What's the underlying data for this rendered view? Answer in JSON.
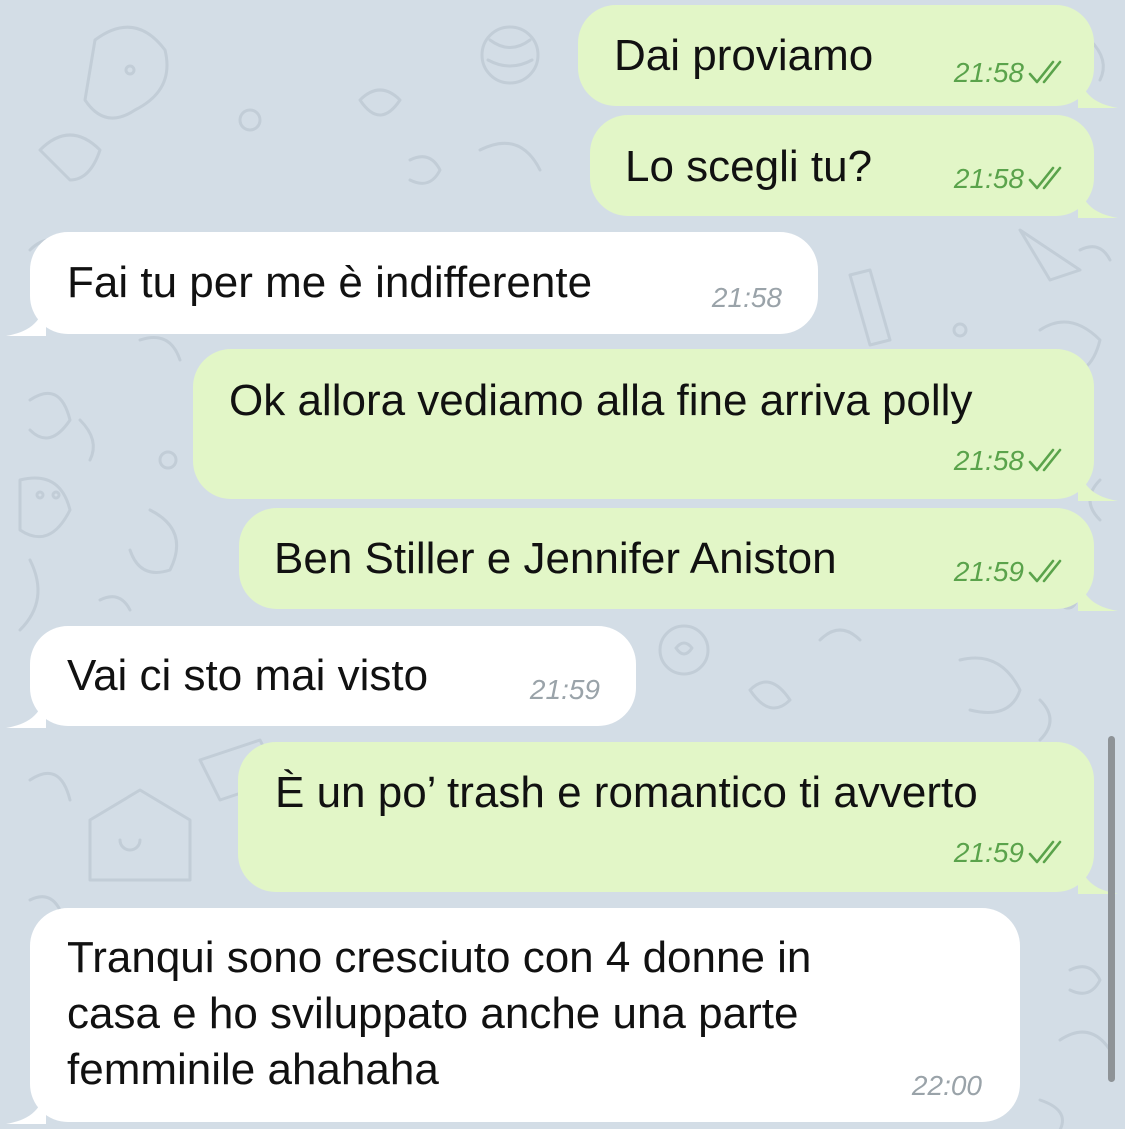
{
  "colors": {
    "background": "#d3dde6",
    "outgoing_bubble": "#e2f6c7",
    "incoming_bubble": "#ffffff",
    "outgoing_meta": "#5aa34b",
    "incoming_meta": "#9aa3a9"
  },
  "messages": [
    {
      "direction": "outgoing",
      "text": "Dai proviamo",
      "time": "21:58",
      "status_icon": "double-check-icon"
    },
    {
      "direction": "outgoing",
      "text": "Lo scegli tu?",
      "time": "21:58",
      "status_icon": "double-check-icon"
    },
    {
      "direction": "incoming",
      "text": "Fai tu per me è indifferente",
      "time": "21:58"
    },
    {
      "direction": "outgoing",
      "text": "Ok allora vediamo alla fine arriva polly",
      "time": "21:58",
      "status_icon": "double-check-icon"
    },
    {
      "direction": "outgoing",
      "text": "Ben Stiller e Jennifer Aniston",
      "time": "21:59",
      "status_icon": "double-check-icon"
    },
    {
      "direction": "incoming",
      "text": "Vai ci sto mai visto",
      "time": "21:59"
    },
    {
      "direction": "outgoing",
      "text": "È un po’ trash e romantico ti avverto",
      "time": "21:59",
      "status_icon": "double-check-icon"
    },
    {
      "direction": "incoming",
      "text": "Tranqui sono cresciuto con 4 donne in\ncasa e ho sviluppato anche una parte\nfemminile ahahaha",
      "time": "22:00"
    }
  ]
}
